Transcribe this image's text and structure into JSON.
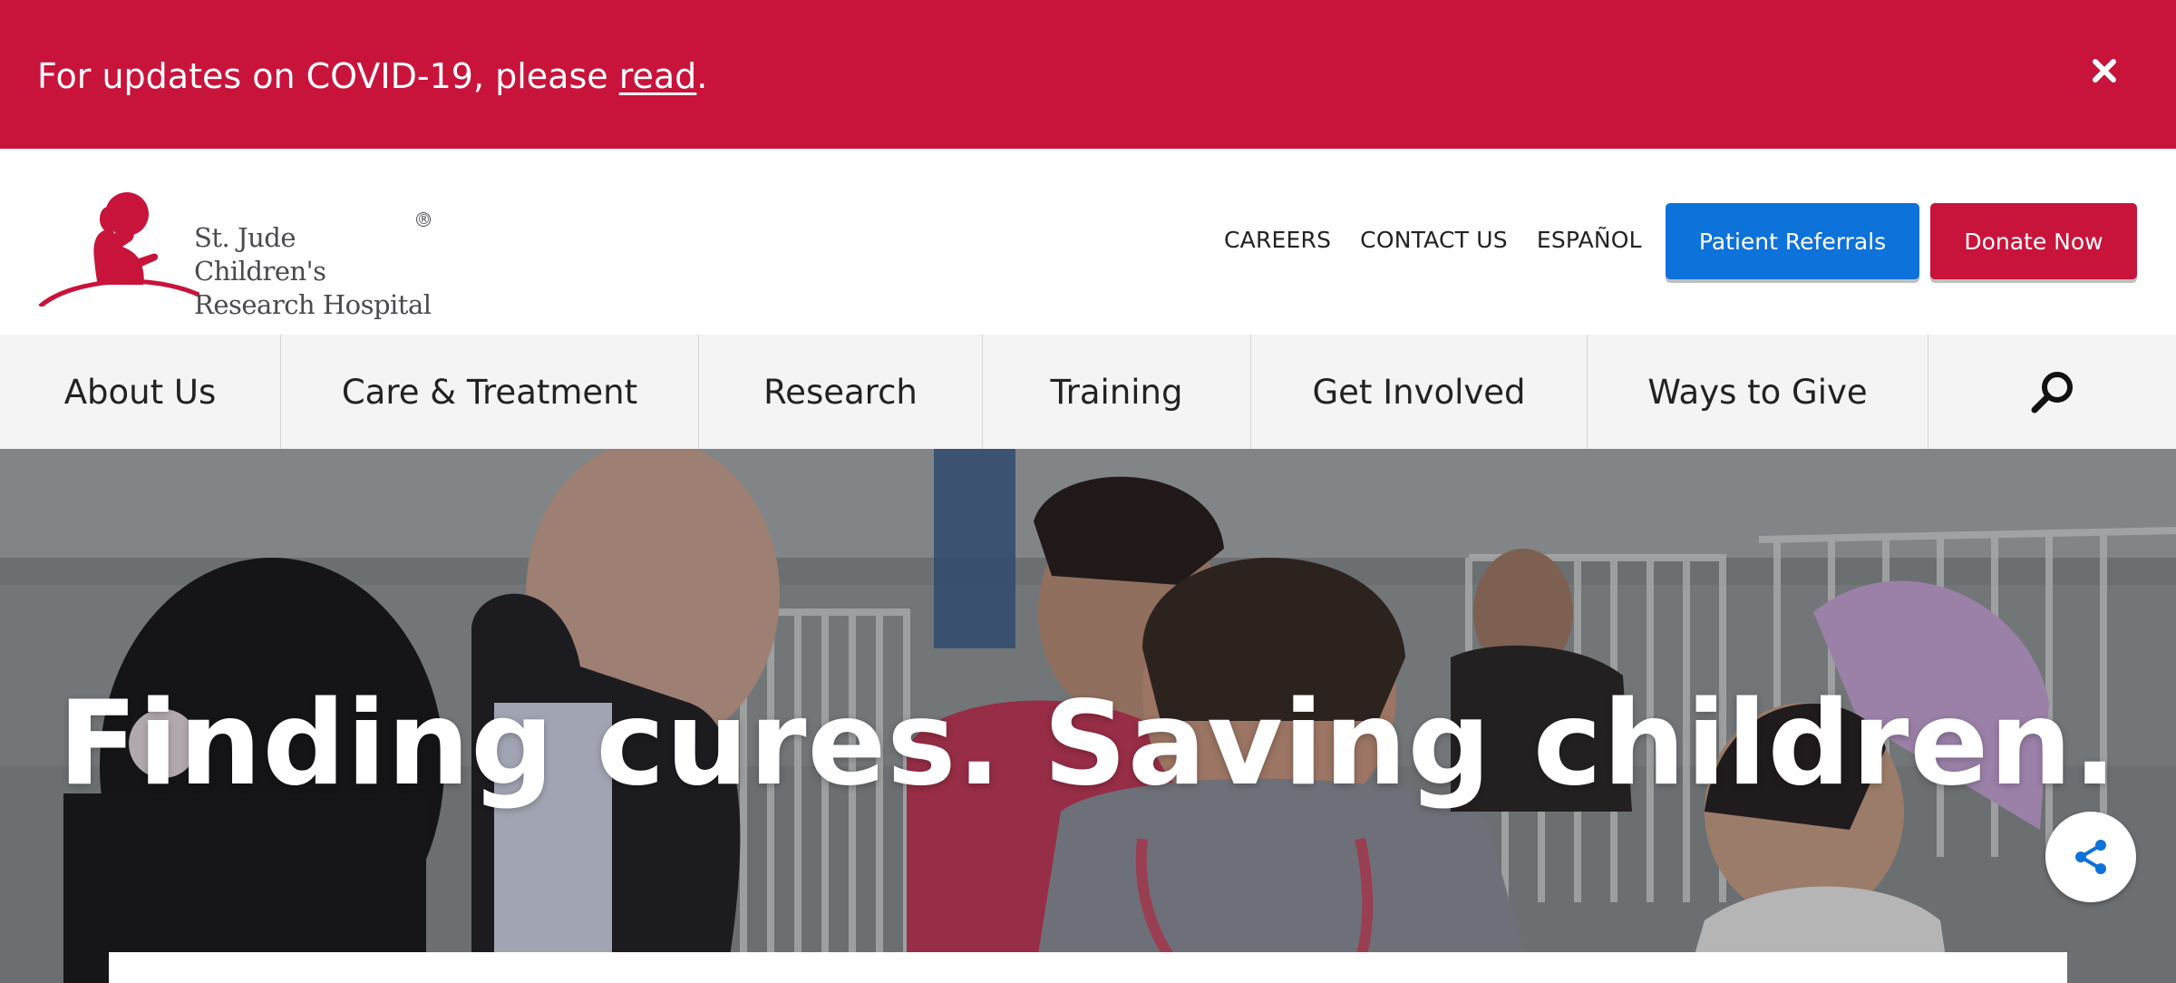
{
  "alert": {
    "text": "For updates on COVID-19, please ",
    "link": "read",
    "suffix": ".",
    "close_icon": "close-icon"
  },
  "logo": {
    "line1": "St. Jude Children's",
    "line2": "Research Hospital",
    "reg": "®",
    "color": "#c8133b"
  },
  "utility": {
    "links": [
      "CAREERS",
      "CONTACT US",
      "ESPAÑOL"
    ]
  },
  "buttons": {
    "referrals": "Patient Referrals",
    "donate": "Donate Now"
  },
  "nav": {
    "items": [
      "About Us",
      "Care & Treatment",
      "Research",
      "Training",
      "Get Involved",
      "Ways to Give"
    ],
    "search_icon": "search-icon"
  },
  "hero": {
    "title": "Finding cures. Saving children.",
    "share_icon": "share-icon"
  },
  "colors": {
    "brand_red": "#c8133b",
    "brand_blue": "#0d72d9"
  }
}
